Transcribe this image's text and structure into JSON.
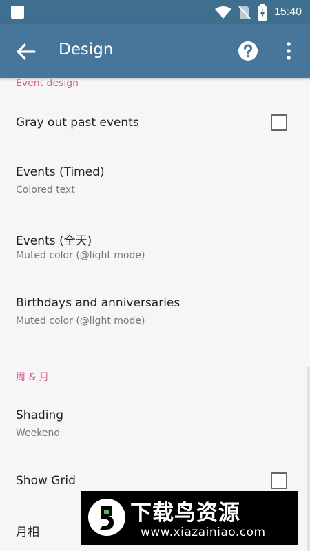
{
  "status_bar": {
    "time": "15:40",
    "icons": [
      "square-notification-icon",
      "wifi-icon",
      "no-sim-icon",
      "battery-charging-icon"
    ]
  },
  "toolbar": {
    "title": "Design",
    "back_icon": "arrow-left-icon",
    "help_icon": "help-circle-icon",
    "more_icon": "more-vert-icon"
  },
  "sections": {
    "event_design": {
      "title": "Event design",
      "gray_out": {
        "title": "Gray out past events",
        "checked": false
      },
      "events_timed": {
        "title": "Events (Timed)",
        "summary": "Colored text"
      },
      "events_allday": {
        "title": "Events (全天)",
        "summary": "Muted color (@light mode)"
      },
      "birthdays": {
        "title": "Birthdays and anniversaries",
        "summary": "Muted color (@light mode)"
      }
    },
    "week_month": {
      "title": "周 & 月",
      "shading": {
        "title": "Shading",
        "summary": "Weekend"
      },
      "show_grid": {
        "title": "Show Grid",
        "checked": false
      },
      "moon_phase": {
        "title": "月相"
      }
    }
  },
  "watermark": {
    "main": "下载鸟资源",
    "sub": "www.xiazainiao.com"
  },
  "colors": {
    "status_bar": "#3f6f8e",
    "toolbar": "#47769a",
    "accent": "#e0559a",
    "background": "#f6f6f6"
  }
}
